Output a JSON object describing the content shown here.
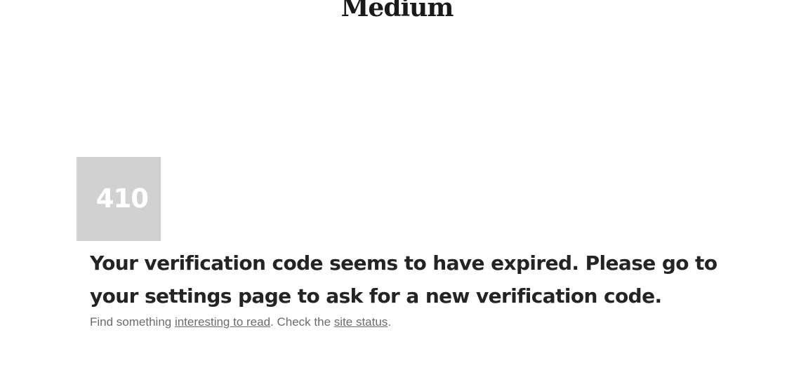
{
  "header": {
    "logo_text": "Medium"
  },
  "error": {
    "code": "410",
    "message": "Your verification code seems to have expired. Please go to your settings page to ask for a new verification code."
  },
  "help": {
    "prefix": "Find something ",
    "link_read": "interesting to read",
    "middle": ". Check the ",
    "link_status": "site status",
    "suffix": "."
  },
  "colors": {
    "code_box_bg": "#d1d1d1",
    "heading_text": "#242424",
    "muted_text": "#6b6b6b"
  }
}
